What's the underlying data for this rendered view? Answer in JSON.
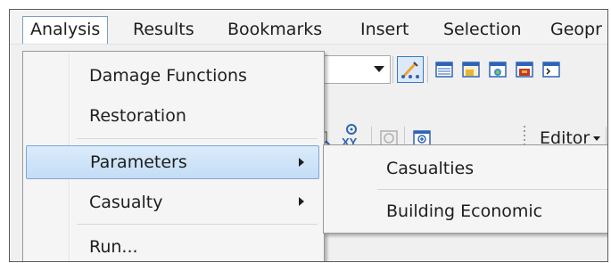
{
  "menubar": {
    "items": [
      {
        "label": "Analysis"
      },
      {
        "label": "Results"
      },
      {
        "label": "Bookmarks"
      },
      {
        "label": "Insert"
      },
      {
        "label": "Selection"
      },
      {
        "label": "Geopr"
      }
    ]
  },
  "analysis_menu": {
    "items": [
      {
        "label": "Damage Functions",
        "has_submenu": false
      },
      {
        "label": "Restoration",
        "has_submenu": false
      },
      {
        "label": "Parameters",
        "has_submenu": true,
        "highlighted": true
      },
      {
        "label": "Casualty",
        "has_submenu": true
      },
      {
        "label": "Run...",
        "has_submenu": false
      }
    ]
  },
  "parameters_submenu": {
    "items": [
      {
        "label": "Casualties"
      },
      {
        "label": "Building Economic"
      }
    ]
  },
  "toolbar": {
    "editor_label": "Editor",
    "icons": [
      "editing-pencil-icon",
      "table-icon",
      "catalog-icon",
      "toolbox-icon",
      "model-icon",
      "python-window-icon",
      "add-xy-data-icon",
      "xy-icon",
      "time-slider-icon",
      "zoom-box-icon"
    ]
  },
  "colors": {
    "highlight": "#c4ddf6",
    "highlight_border": "#7ba7d6",
    "menu_background": "#f5f5f5"
  }
}
